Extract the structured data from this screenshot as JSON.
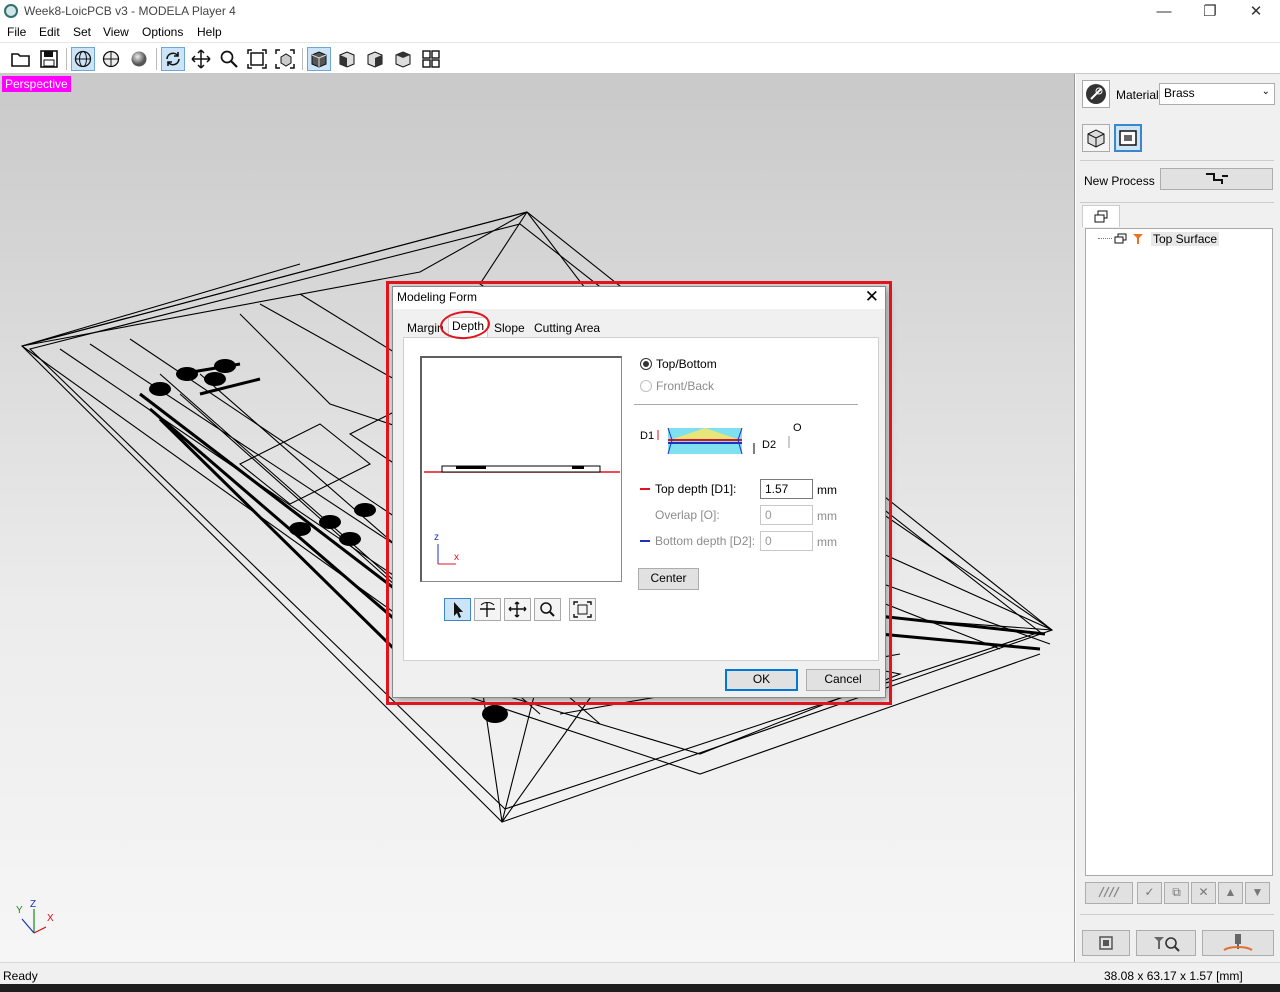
{
  "window": {
    "title": "Week8-LoicPCB v3 - MODELA Player 4",
    "minimize": "—",
    "restore": "❐",
    "close": "✕"
  },
  "menu": [
    "File",
    "Edit",
    "Set",
    "View",
    "Options",
    "Help"
  ],
  "toolbar_icons": [
    "open-icon",
    "save-icon",
    "wireframe-icon",
    "sphere-outline-icon",
    "shaded-sphere-icon",
    "rotate-icon",
    "pan-icon",
    "zoom-icon",
    "fit-icon",
    "fit-selection-icon",
    "view-iso-icon",
    "view-front-icon",
    "view-right-icon",
    "view-top-icon",
    "view-grid-icon"
  ],
  "viewport": {
    "label": "Perspective",
    "axes": {
      "y": "Y",
      "z": "Z",
      "x": "X"
    }
  },
  "right_panel": {
    "material_label": "Material",
    "material_value": "Brass",
    "new_process_label": "New Process",
    "tree_item": "Top Surface"
  },
  "dialog": {
    "title": "Modeling Form",
    "close": "✕",
    "tabs": [
      "Margin",
      "Depth",
      "Slope",
      "Cutting Area"
    ],
    "active_tab": "Depth",
    "preview_axes": {
      "z": "z",
      "x": "x"
    },
    "options": {
      "top_bottom": "Top/Bottom",
      "front_back": "Front/Back"
    },
    "diagram_labels": {
      "d1": "D1",
      "d2": "D2",
      "o": "O"
    },
    "fields": {
      "top_depth_label": "Top depth [D1]:",
      "top_depth_value": "1.57",
      "overlap_label": "Overlap [O]:",
      "overlap_value": "0",
      "bottom_depth_label": "Bottom depth [D2]:",
      "bottom_depth_value": "0",
      "unit": "mm"
    },
    "center_button": "Center",
    "ok_button": "OK",
    "cancel_button": "Cancel"
  },
  "status": {
    "left": "Ready",
    "right": "38.08 x 63.17 x 1.57 [mm]"
  },
  "colors": {
    "highlight_red": "#e0141e",
    "perspective_badge": "#ff00ff",
    "toggle_active": "#cce4f7"
  }
}
